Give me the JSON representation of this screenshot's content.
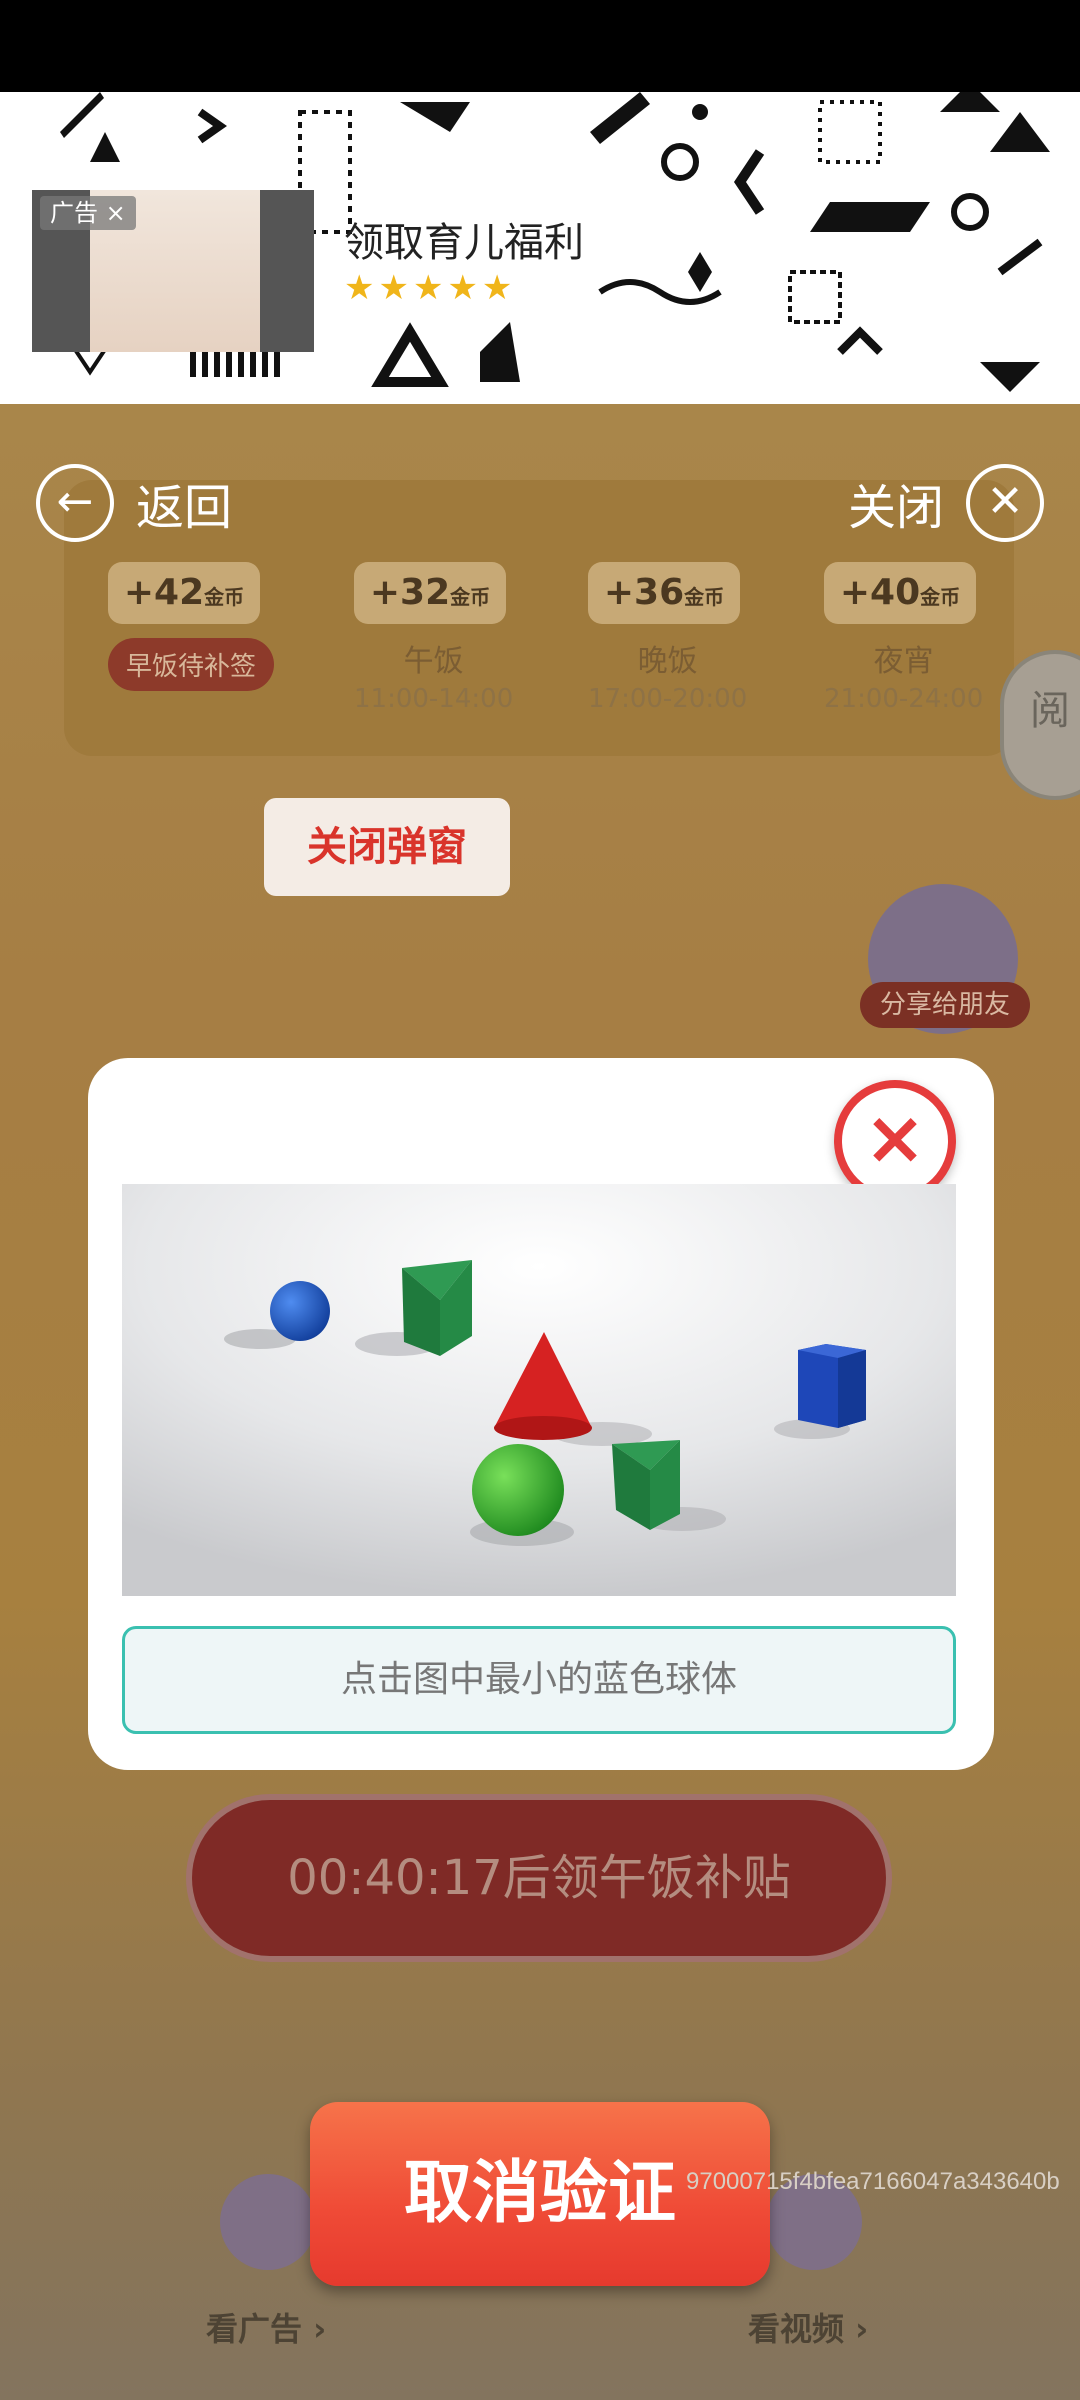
{
  "ad": {
    "tag": "广告 ×",
    "title": "领取育儿福利",
    "stars": "★★★★★"
  },
  "nav": {
    "back_label": "返回",
    "close_label": "关闭"
  },
  "meals": [
    {
      "coin": "+42",
      "unit": "金币",
      "badge": "早饭待补签"
    },
    {
      "coin": "+32",
      "unit": "金币",
      "name": "午饭",
      "time": "11:00-14:00"
    },
    {
      "coin": "+36",
      "unit": "金币",
      "name": "晚饭",
      "time": "17:00-20:00"
    },
    {
      "coin": "+40",
      "unit": "金币",
      "name": "夜宵",
      "time": "21:00-24:00"
    }
  ],
  "side_badge": "阅",
  "close_popup_label": "关闭弹窗",
  "share_label": "分享给朋友",
  "countdown_text": "00:40:17后领午饭补贴",
  "captcha": {
    "prompt": "点击图中最小的蓝色球体",
    "close_icon": "close-icon"
  },
  "bottom": {
    "watch_ad": "看广告 ›",
    "watch_video": "看视频 ›"
  },
  "cancel_label": "取消验证",
  "session_id": "97000715f4bfea7166047a343640b"
}
